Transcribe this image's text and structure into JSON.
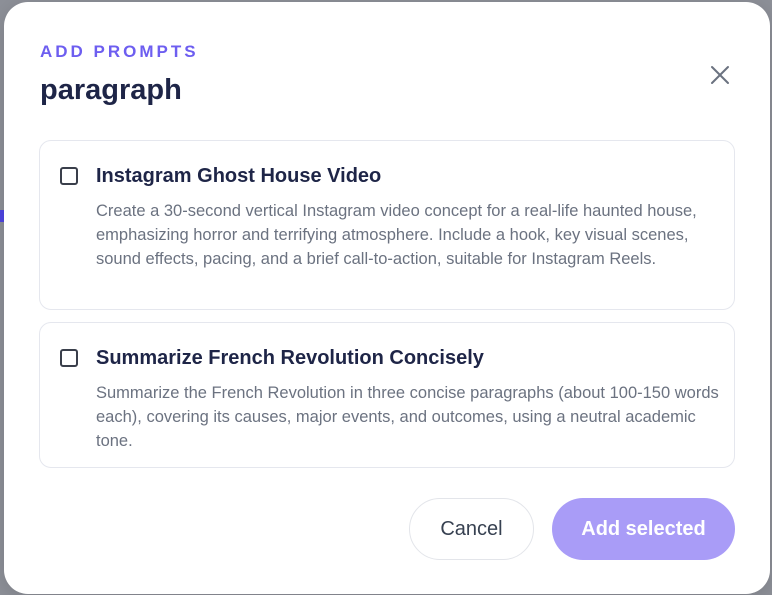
{
  "modal": {
    "eyebrow": "ADD PROMPTS",
    "title": "paragraph",
    "close_icon": "close-icon"
  },
  "prompts": [
    {
      "title": "Instagram Ghost House Video",
      "description": "Create a 30-second vertical Instagram video concept for a real-life haunted house, emphasizing horror and terrifying atmosphere. Include a hook, key visual scenes, sound effects, pacing, and a brief call-to-action, suitable for Instagram Reels.",
      "checked": false
    },
    {
      "title": "Summarize French Revolution Concisely",
      "description": "Summarize the French Revolution in three concise paragraphs (about 100-150 words each), covering its causes, major events, and outcomes, using a neutral academic tone.",
      "checked": false
    }
  ],
  "footer": {
    "cancel_label": "Cancel",
    "add_label": "Add selected"
  },
  "colors": {
    "accent": "#6d5ef0",
    "primary_button_disabled": "#a99cf7",
    "heading": "#1e2547",
    "body_text": "#6b7280"
  }
}
